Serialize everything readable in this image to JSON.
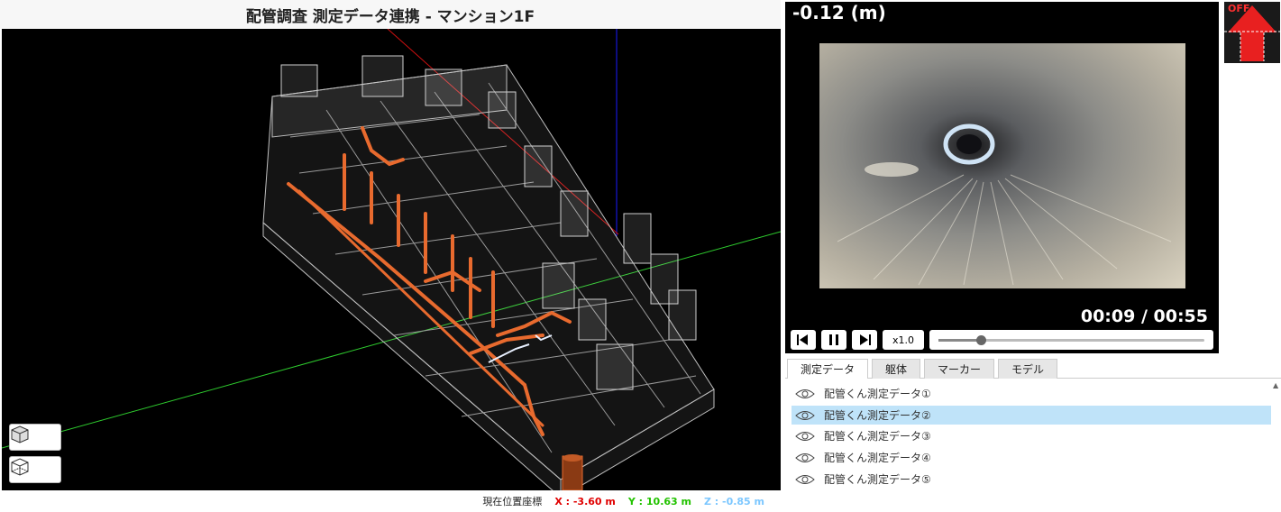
{
  "title": "配管調査 測定データ連携 - マンション1F",
  "viewer": {
    "view_buttons": [
      {
        "icon": "cube-solid-icon"
      },
      {
        "icon": "cube-wireframe-icon"
      }
    ]
  },
  "coords": {
    "label": "現在位置座標",
    "x": "X : -3.60 m",
    "y": "Y : 10.63 m",
    "z": "Z : -0.85 m",
    "colors": {
      "x": "#e00000",
      "y": "#22c200",
      "z": "#7cc7ff"
    }
  },
  "video": {
    "depth": "-0.12 (m)",
    "time": "00:09 / 00:55",
    "speed": "x1.0",
    "progress": 0.16,
    "controls": [
      {
        "icon": "step-back-icon"
      },
      {
        "icon": "pause-icon"
      },
      {
        "icon": "step-forward-icon"
      }
    ]
  },
  "toggle": {
    "label": "OFF",
    "icon": "up-arrow-icon",
    "color": "#e82020"
  },
  "tabs": [
    {
      "label": "測定データ",
      "active": true
    },
    {
      "label": "躯体",
      "active": false
    },
    {
      "label": "マーカー",
      "active": false
    },
    {
      "label": "モデル",
      "active": false
    }
  ],
  "measurements": [
    {
      "label": "配管くん測定データ①",
      "selected": false,
      "icon": "eye-icon"
    },
    {
      "label": "配管くん測定データ②",
      "selected": true,
      "icon": "eye-icon"
    },
    {
      "label": "配管くん測定データ③",
      "selected": false,
      "icon": "eye-icon"
    },
    {
      "label": "配管くん測定データ④",
      "selected": false,
      "icon": "eye-icon"
    },
    {
      "label": "配管くん測定データ⑤",
      "selected": false,
      "icon": "eye-icon"
    }
  ]
}
